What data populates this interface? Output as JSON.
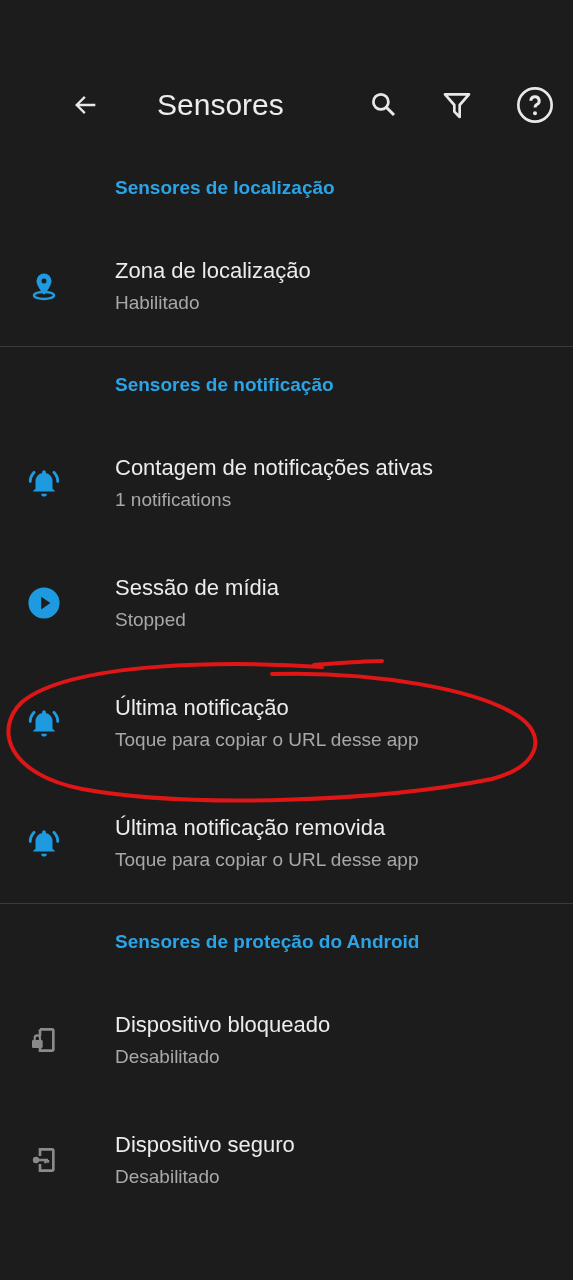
{
  "toolbar": {
    "title": "Sensores"
  },
  "sections": [
    {
      "title": "Sensores de localização",
      "items": [
        {
          "kind": "location",
          "title": "Zona de localização",
          "subtitle": "Habilitado",
          "enabled": true,
          "circled": false
        }
      ]
    },
    {
      "title": "Sensores de notificação",
      "items": [
        {
          "kind": "bell",
          "title": "Contagem de notificações ativas",
          "subtitle": "1 notifications",
          "enabled": true,
          "circled": false
        },
        {
          "kind": "play",
          "title": "Sessão de mídia",
          "subtitle": "Stopped",
          "enabled": true,
          "circled": false
        },
        {
          "kind": "bell",
          "title": "Última notificação",
          "subtitle": "Toque para copiar o URL desse app",
          "enabled": true,
          "circled": true
        },
        {
          "kind": "bell",
          "title": "Última notificação removida",
          "subtitle": "Toque para copiar o URL desse app",
          "enabled": true,
          "circled": false
        }
      ]
    },
    {
      "title": "Sensores de proteção do Android",
      "items": [
        {
          "kind": "lock",
          "title": "Dispositivo bloqueado",
          "subtitle": "Desabilitado",
          "enabled": false,
          "circled": false
        },
        {
          "kind": "key",
          "title": "Dispositivo seguro",
          "subtitle": "Desabilitado",
          "enabled": false,
          "circled": false
        }
      ]
    }
  ]
}
